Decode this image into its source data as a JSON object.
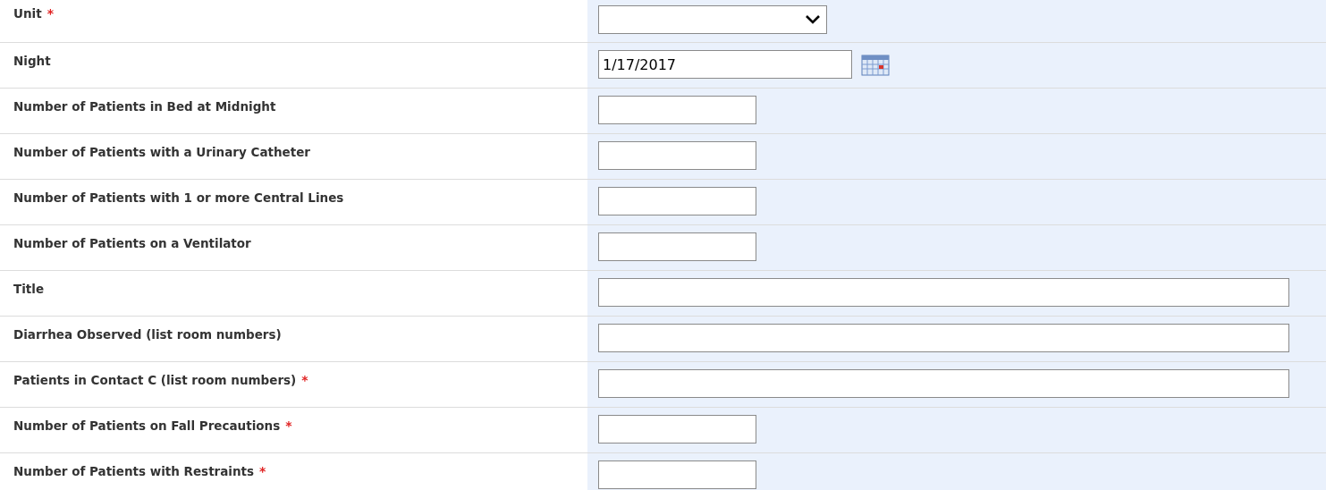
{
  "fields": [
    {
      "label": "Unit",
      "required_mark": "*",
      "kind": "select"
    },
    {
      "label": "Night",
      "kind": "date",
      "value": "1/17/2017"
    },
    {
      "label": "Number of Patients in Bed at Midnight",
      "kind": "number"
    },
    {
      "label": "Number of Patients with a Urinary Catheter",
      "kind": "number"
    },
    {
      "label": "Number of Patients with 1 or more Central Lines",
      "kind": "number"
    },
    {
      "label": "Number of Patients on a Ventilator",
      "kind": "number"
    },
    {
      "label": "Title",
      "kind": "text"
    },
    {
      "label": "Diarrhea Observed (list room numbers)",
      "kind": "text"
    },
    {
      "label": "Patients in Contact C (list room numbers)",
      "required_mark": "*",
      "kind": "text"
    },
    {
      "label": "Number of Patients on Fall Precautions",
      "required_mark": "*",
      "kind": "number"
    },
    {
      "label": "Number of Patients with Restraints",
      "required_mark": "*",
      "kind": "number"
    }
  ]
}
